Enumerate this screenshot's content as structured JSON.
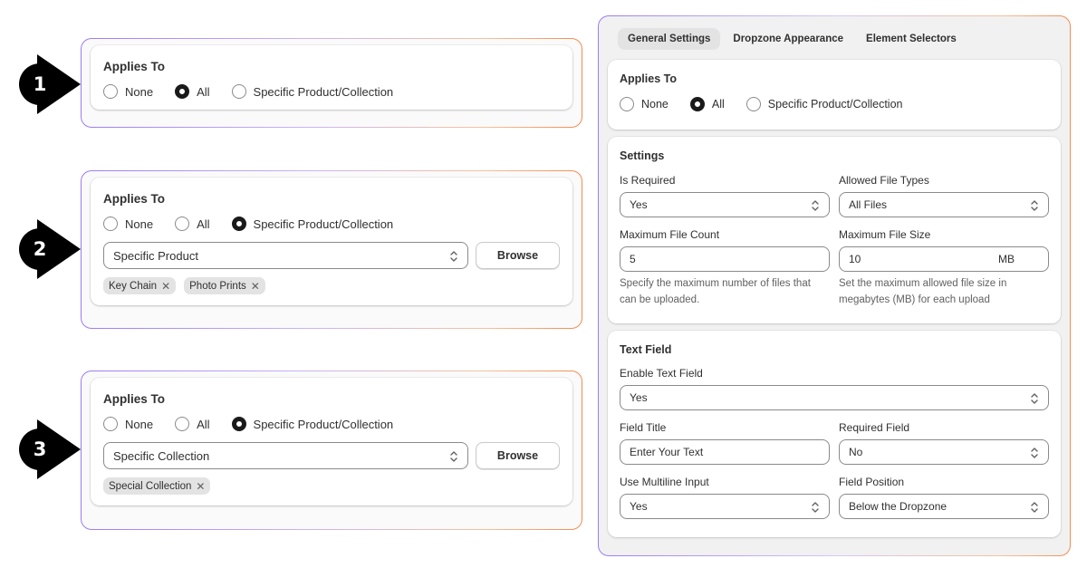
{
  "steps": [
    "1",
    "2",
    "3"
  ],
  "examples": [
    {
      "title": "Applies To",
      "options": [
        "None",
        "All",
        "Specific Product/Collection"
      ],
      "selected": 1
    },
    {
      "title": "Applies To",
      "options": [
        "None",
        "All",
        "Specific Product/Collection"
      ],
      "selected": 2,
      "select_value": "Specific Product",
      "browse_label": "Browse",
      "tags": [
        "Key Chain",
        "Photo Prints"
      ]
    },
    {
      "title": "Applies To",
      "options": [
        "None",
        "All",
        "Specific Product/Collection"
      ],
      "selected": 2,
      "select_value": "Specific Collection",
      "browse_label": "Browse",
      "tags": [
        "Special Collection"
      ]
    }
  ],
  "panel": {
    "tabs": [
      "General Settings",
      "Dropzone Appearance",
      "Element Selectors"
    ],
    "active_tab": 0,
    "applies_to": {
      "title": "Applies To",
      "options": [
        "None",
        "All",
        "Specific Product/Collection"
      ],
      "selected": 1
    },
    "settings": {
      "title": "Settings",
      "is_required_label": "Is Required",
      "is_required_value": "Yes",
      "file_types_label": "Allowed File Types",
      "file_types_value": "All Files",
      "max_count_label": "Maximum File Count",
      "max_count_value": "5",
      "max_count_help": "Specify the maximum number of files that can be uploaded.",
      "max_size_label": "Maximum File Size",
      "max_size_value": "10",
      "max_size_unit": "MB",
      "max_size_help": "Set the maximum allowed file size in megabytes (MB) for each upload"
    },
    "text_field": {
      "title": "Text Field",
      "enable_label": "Enable Text Field",
      "enable_value": "Yes",
      "field_title_label": "Field Title",
      "field_title_value": "Enter Your Text",
      "required_label": "Required Field",
      "required_value": "No",
      "multiline_label": "Use Multiline Input",
      "multiline_value": "Yes",
      "position_label": "Field Position",
      "position_value": "Below the Dropzone"
    }
  },
  "colors": {
    "frame_gradient_start": "#9b7cf2",
    "frame_gradient_end": "#f28b50",
    "selected_radio": "#1a1a1a",
    "tag_bg": "#e3e3e3"
  }
}
